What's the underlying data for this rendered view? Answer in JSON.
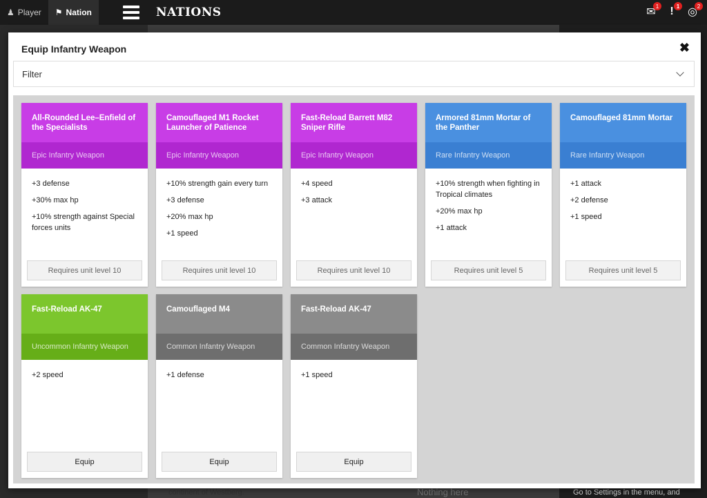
{
  "topbar": {
    "player_label": "Player",
    "nation_label": "Nation",
    "brand": "NATIONS",
    "mail_badge": "1",
    "alert_badge": "1",
    "target_badge": "2"
  },
  "background": {
    "text_left": "continent of Westberg.",
    "text_mid": "Nothing here",
    "text_right": "Go to Settings in the menu, and"
  },
  "modal": {
    "title": "Equip Infantry Weapon",
    "filter_label": "Filter"
  },
  "cards": [
    {
      "name": "All-Rounded Lee–Enfield of the Specialists",
      "rarity": "Epic Infantry Weapon",
      "stats": [
        "+3 defense",
        "+30% max hp",
        "+10% strength against Special forces units"
      ],
      "action": "Requires unit level 10"
    },
    {
      "name": "Camouflaged M1 Rocket Launcher of Patience",
      "rarity": "Epic Infantry Weapon",
      "stats": [
        "+10% strength gain every turn",
        "+3 defense",
        "+20% max hp",
        "+1 speed"
      ],
      "action": "Requires unit level 10"
    },
    {
      "name": "Fast-Reload Barrett M82 Sniper Rifle",
      "rarity": "Epic Infantry Weapon",
      "stats": [
        "+4 speed",
        "+3 attack"
      ],
      "action": "Requires unit level 10"
    },
    {
      "name": "Armored 81mm Mortar of the Panther",
      "rarity": "Rare Infantry Weapon",
      "stats": [
        "+10% strength when fighting in Tropical climates",
        "+20% max hp",
        "+1 attack"
      ],
      "action": "Requires unit level 5"
    },
    {
      "name": "Camouflaged 81mm Mortar",
      "rarity": "Rare Infantry Weapon",
      "stats": [
        "+1 attack",
        "+2 defense",
        "+1 speed"
      ],
      "action": "Requires unit level 5"
    },
    {
      "name": "Fast-Reload AK-47",
      "rarity": "Uncommon Infantry Weapon",
      "stats": [
        "+2 speed"
      ],
      "action": "Equip"
    },
    {
      "name": "Camouflaged M4",
      "rarity": "Common Infantry Weapon",
      "stats": [
        "+1 defense"
      ],
      "action": "Equip"
    },
    {
      "name": "Fast-Reload AK-47",
      "rarity": "Common Infantry Weapon",
      "stats": [
        "+1 speed"
      ],
      "action": "Equip"
    }
  ],
  "colors": {
    "epic": "#c83de6",
    "rare": "#4a90e0",
    "uncommon": "#7cc62d",
    "common": "#8b8b8b"
  }
}
